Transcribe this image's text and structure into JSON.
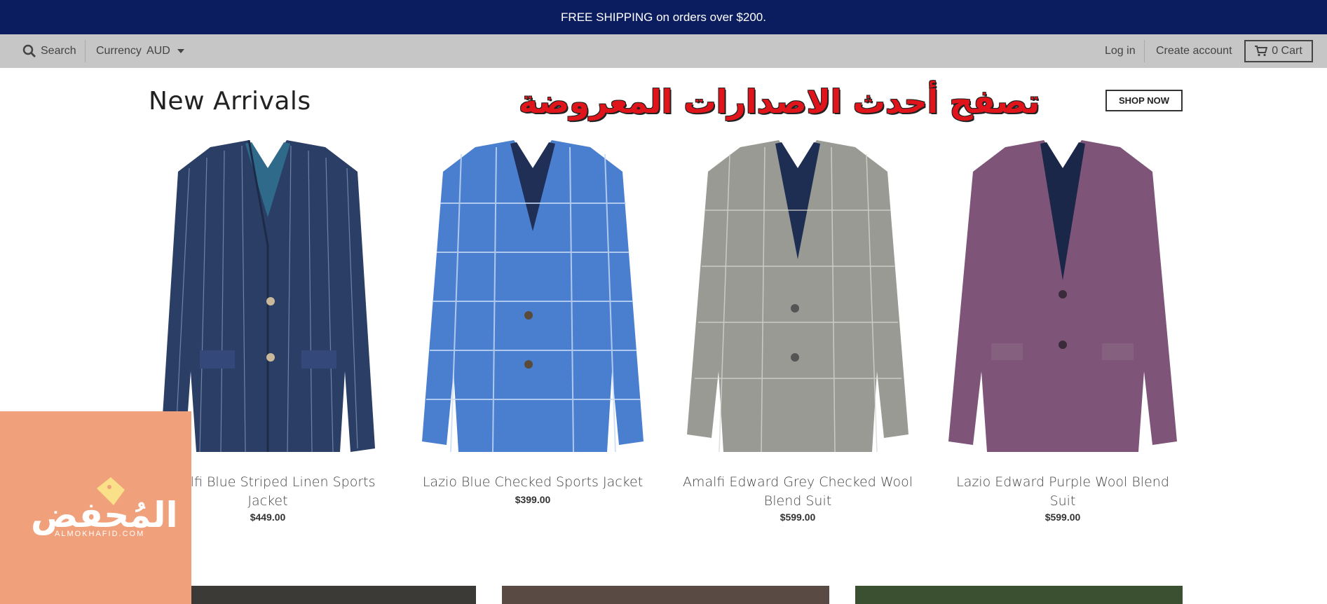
{
  "announcement": "FREE SHIPPING on orders over $200.",
  "topbar": {
    "search_label": "Search",
    "currency_label": "Currency",
    "currency_value": "AUD",
    "login_label": "Log in",
    "create_account_label": "Create account",
    "cart_label": "0 Cart"
  },
  "section": {
    "title": "New Arrivals",
    "overlay_text": "تصفح أحدث الاصدارات المعروضة",
    "shop_now_label": "SHOP NOW"
  },
  "products": [
    {
      "name": "Amalfi Blue Striped Linen Sports Jacket",
      "price": "$449.00",
      "color": "#2b3f66"
    },
    {
      "name": "Lazio Blue Checked Sports Jacket",
      "price": "$399.00",
      "color": "#4a7fd0"
    },
    {
      "name": "Amalfi Edward Grey Checked Wool Blend Suit",
      "price": "$599.00",
      "color": "#9a9a95"
    },
    {
      "name": "Lazio Edward Purple Wool Blend Suit",
      "price": "$599.00",
      "color": "#7e5578"
    }
  ],
  "watermark": {
    "logo_text": "المُحفض",
    "logo_sub": "ALMOKHAFID.COM"
  },
  "colors": {
    "announcement_bg": "#0b1d5e",
    "topbar_bg": "#c6c6c6",
    "watermark_bg": "#f0a07a",
    "overlay_red": "#e0151b"
  }
}
